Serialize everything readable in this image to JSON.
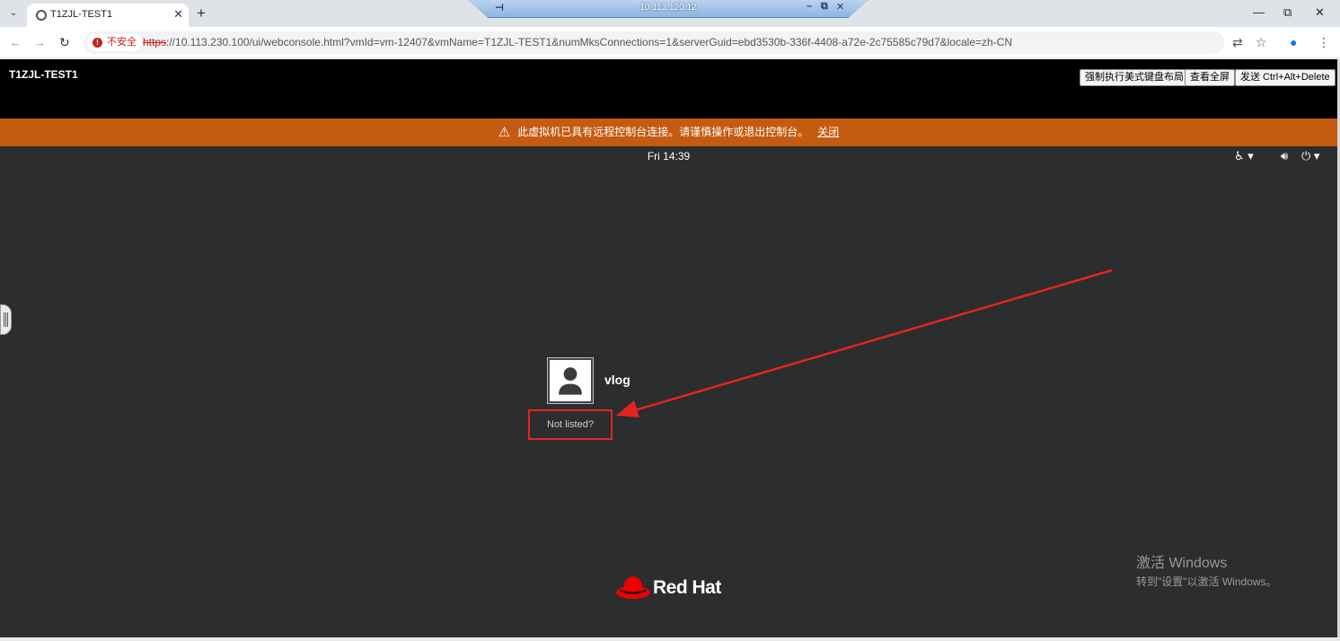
{
  "browser": {
    "tab_title": "T1ZJL-TEST1",
    "tab_close": "✕",
    "new_tab": "+",
    "tab_search": "⌄",
    "rdp_host": "10.113.120.12",
    "security_label": "不安全",
    "url_scheme": "https",
    "url_rest": "://10.113.230.100/ui/webconsole.html?vmId=vm-12407&vmName=T1ZJL-TEST1&numMksConnections=1&serverGuid=ebd3530b-336f-4408-a72e-2c75585c79d7&locale=zh-CN"
  },
  "console": {
    "vm_name": "T1ZJL-TEST1",
    "buttons": [
      "强制执行美式键盘布局",
      "查看全屏",
      "发送 Ctrl+Alt+Delete"
    ],
    "warning_text": "此虚拟机已具有远程控制台连接。请谨慎操作或退出控制台。",
    "warning_close": "关闭",
    "warning_color": "#c55a11"
  },
  "gdm": {
    "clock": "Fri 14:39",
    "user_name": "vlog",
    "not_listed": "Not listed?",
    "brand": "Red Hat",
    "brand_color": "#ee0000",
    "background_color": "#2b2d2e"
  },
  "watermark": {
    "title": "激活 Windows",
    "subtitle": "转到\"设置\"以激活 Windows。"
  },
  "annotation": {
    "color": "#e52420"
  }
}
